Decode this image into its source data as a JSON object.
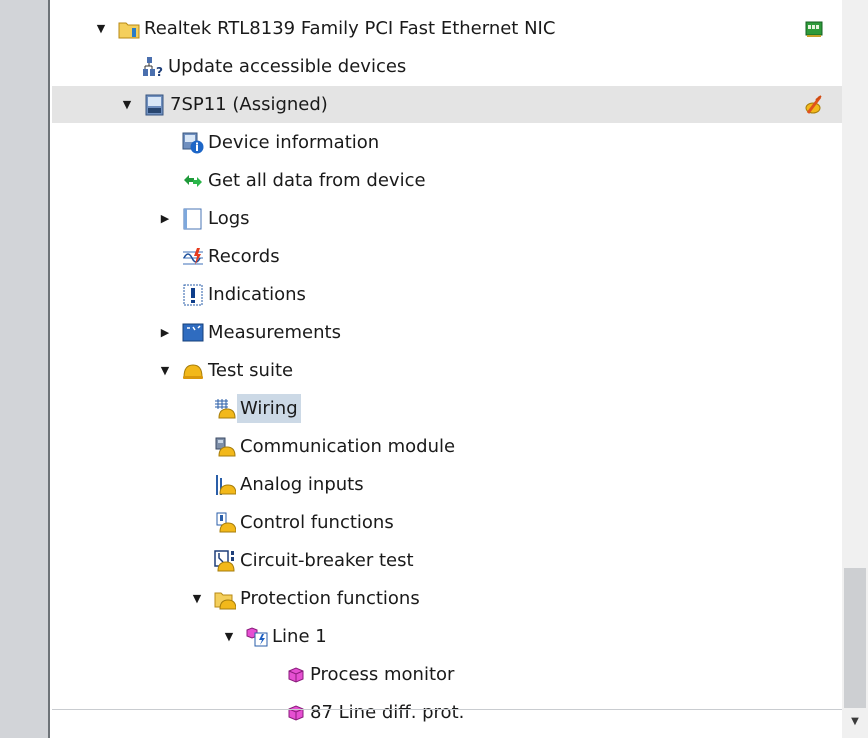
{
  "tree": {
    "items": [
      {
        "label": "Realtek RTL8139 Family PCI Fast Ethernet NIC",
        "icon": "folder-network-icon",
        "expanded": true,
        "right_icon": "network-adapter-icon"
      },
      {
        "label": "Update accessible devices",
        "icon": "update-devices-icon"
      },
      {
        "label": "7SP11 (Assigned)",
        "icon": "device-icon",
        "expanded": true,
        "right_icon": "online-connection-icon"
      },
      {
        "label": "Device information",
        "icon": "device-information-icon"
      },
      {
        "label": "Get all data from device",
        "icon": "get-data-icon"
      },
      {
        "label": "Logs",
        "icon": "logs-icon",
        "expanded": false
      },
      {
        "label": "Records",
        "icon": "records-icon"
      },
      {
        "label": "Indications",
        "icon": "indications-icon"
      },
      {
        "label": "Measurements",
        "icon": "measurements-icon",
        "expanded": false
      },
      {
        "label": "Test suite",
        "icon": "test-suite-icon",
        "expanded": true
      },
      {
        "label": "Wiring",
        "icon": "wiring-icon",
        "selected": true
      },
      {
        "label": "Communication module",
        "icon": "communication-module-icon"
      },
      {
        "label": "Analog inputs",
        "icon": "analog-inputs-icon"
      },
      {
        "label": "Control functions",
        "icon": "control-functions-icon"
      },
      {
        "label": "Circuit-breaker test",
        "icon": "circuit-breaker-icon"
      },
      {
        "label": "Protection functions",
        "icon": "protection-functions-icon",
        "expanded": true
      },
      {
        "label": "Line 1",
        "icon": "line-icon",
        "expanded": true
      },
      {
        "label": "Process monitor",
        "icon": "function-block-icon"
      },
      {
        "label": "87 Line diff. prot.",
        "icon": "function-block-icon"
      }
    ]
  },
  "colors": {
    "selection": "#ccd9e6",
    "shaded_row": "#e4e4e4",
    "helmet": "#f2b81a"
  }
}
